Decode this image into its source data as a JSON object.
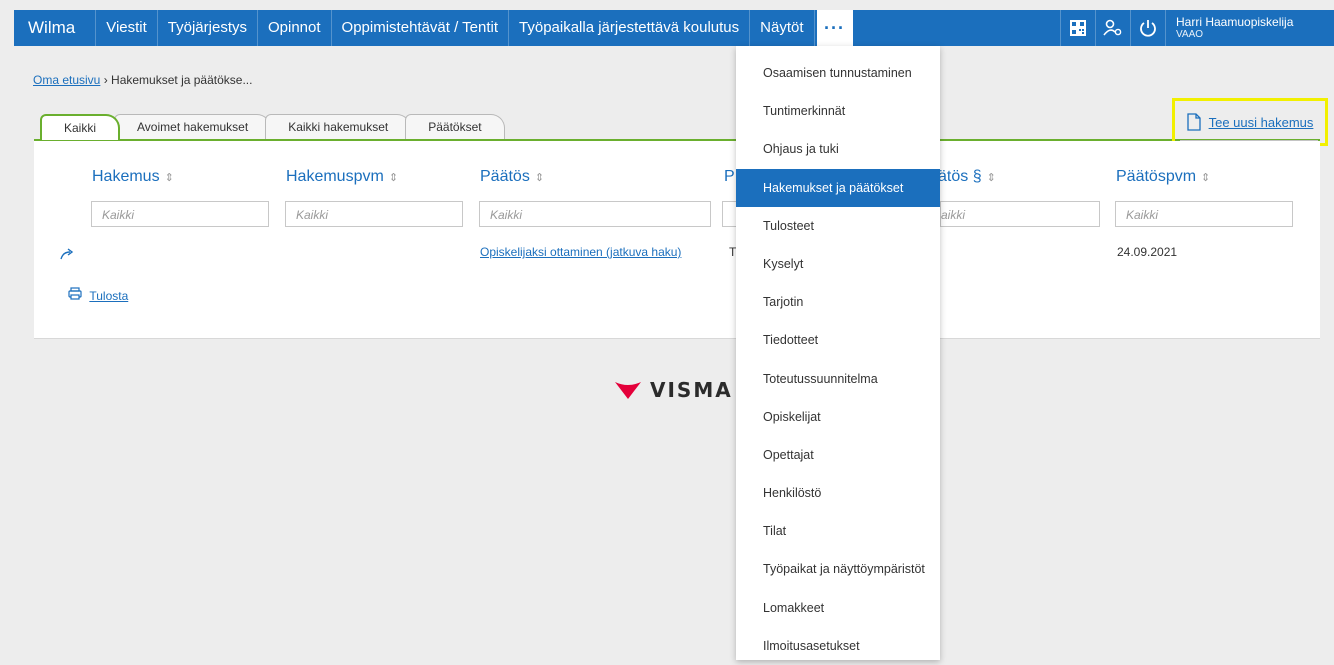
{
  "nav": {
    "brand": "Wilma",
    "items": [
      "Viestit",
      "Työjärjestys",
      "Opinnot",
      "Oppimistehtävät / Tentit",
      "Työpaikalla järjestettävä koulutus",
      "Näytöt"
    ],
    "more": "···",
    "user_name": "Harri Haamuopiskelija",
    "user_org": "VAAO"
  },
  "breadcrumb": {
    "home": "Oma etusivu",
    "separator": "›",
    "current": "Hakemukset ja päätökse..."
  },
  "tabs": [
    "Kaikki",
    "Avoimet hakemukset",
    "Kaikki hakemukset",
    "Päätökset"
  ],
  "table": {
    "columns": [
      "Hakemus",
      "Hakemuspvm",
      "Päätös",
      "P",
      "ätös §",
      "Päätöspvm"
    ],
    "filter_placeholder": "Kaikki",
    "filter_partial": "aikki",
    "row": {
      "decision": "Opiskelijaksi ottaminen (jatkuva haku)",
      "partial": "T",
      "date": "24.09.2021"
    }
  },
  "actions": {
    "print": "Tulosta",
    "new_application": "Tee uusi hakemus"
  },
  "logo": {
    "text": "VISMA",
    "color": "#e4003a"
  },
  "dropdown": {
    "items": [
      "Osaamisen tunnustaminen",
      "Tuntimerkinnät",
      "Ohjaus ja tuki",
      "Hakemukset ja päätökset",
      "Tulosteet",
      "Kyselyt",
      "Tarjotin",
      "Tiedotteet",
      "Toteutussuunnitelma",
      "Opiskelijat",
      "Opettajat",
      "Henkilöstö",
      "Tilat",
      "Työpaikat ja näyttöympäristöt",
      "Lomakkeet",
      "Ilmoitusasetukset"
    ],
    "active": "Hakemukset ja päätökset"
  },
  "colors": {
    "primary": "#1b6fbd",
    "tab_accent": "#6aaf2e",
    "highlight": "#f2f000"
  }
}
